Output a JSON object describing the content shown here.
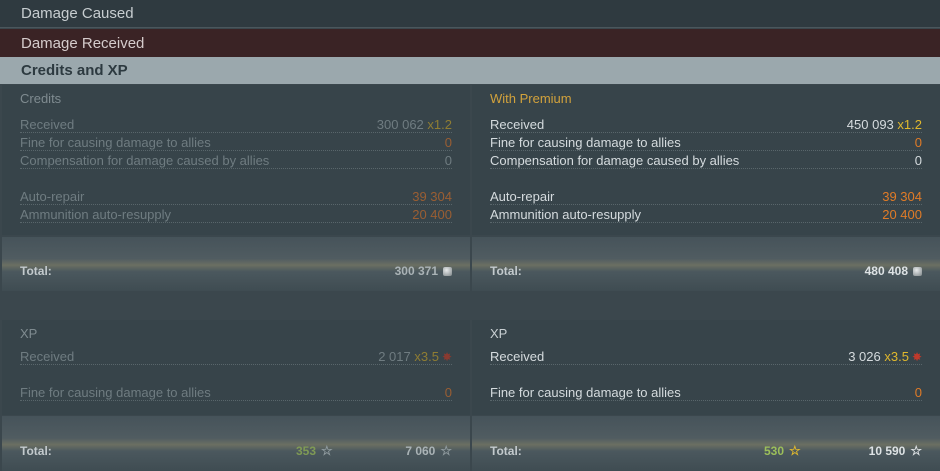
{
  "tabs": {
    "damage_caused": "Damage Caused",
    "damage_received": "Damage Received",
    "credits_xp": "Credits and XP"
  },
  "credits": {
    "title": "Credits",
    "received": {
      "label": "Received",
      "value": "300 062",
      "mult": "x1.2"
    },
    "fine": {
      "label": "Fine for causing damage to allies",
      "value": "0"
    },
    "compensation": {
      "label": "Compensation for damage caused by allies",
      "value": "0"
    },
    "auto_repair": {
      "label": "Auto-repair",
      "value": "39 304"
    },
    "auto_resupply": {
      "label": "Ammunition auto-resupply",
      "value": "20 400"
    },
    "total_label": "Total:",
    "total_value": "300 371"
  },
  "premium": {
    "title": "With Premium",
    "received": {
      "label": "Received",
      "value": "450 093",
      "mult": "x1.2"
    },
    "fine": {
      "label": "Fine for causing damage to allies",
      "value": "0"
    },
    "compensation": {
      "label": "Compensation for damage caused by allies",
      "value": "0"
    },
    "auto_repair": {
      "label": "Auto-repair",
      "value": "39 304"
    },
    "auto_resupply": {
      "label": "Ammunition auto-resupply",
      "value": "20 400"
    },
    "total_label": "Total:",
    "total_value": "480 408"
  },
  "xp_left": {
    "title": "XP",
    "received": {
      "label": "Received",
      "value": "2 017",
      "mult": "x3.5"
    },
    "fine": {
      "label": "Fine for causing damage to allies",
      "value": "0"
    },
    "total_label": "Total:",
    "total_free": "353",
    "total_xp": "7 060"
  },
  "xp_right": {
    "title": "XP",
    "received": {
      "label": "Received",
      "value": "3 026",
      "mult": "x3.5"
    },
    "fine": {
      "label": "Fine for causing damage to allies",
      "value": "0"
    },
    "total_label": "Total:",
    "total_free": "530",
    "total_xp": "10 590"
  },
  "icons": {
    "credits": "coin-icon",
    "free_xp": "star-icon",
    "xp": "star-icon",
    "multiplier": "xp-multiplier-icon"
  }
}
